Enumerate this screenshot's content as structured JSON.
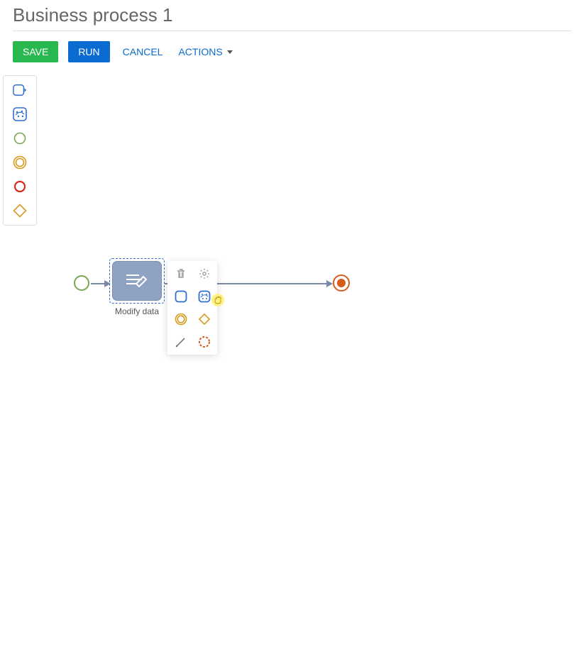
{
  "title": "Business process 1",
  "toolbar": {
    "save": "SAVE",
    "run": "RUN",
    "cancel": "CANCEL",
    "actions": "ACTIONS"
  },
  "palette": {
    "items": [
      {
        "name": "user-task",
        "color": "#2f6fd0"
      },
      {
        "name": "script-task",
        "color": "#2f6fd0"
      },
      {
        "name": "start-event",
        "color": "#7aa854"
      },
      {
        "name": "intermediate-event",
        "color": "#d59a1b"
      },
      {
        "name": "end-event",
        "color": "#d52b1b"
      },
      {
        "name": "gateway",
        "color": "#d59a1b"
      }
    ]
  },
  "canvas": {
    "task_label": "Modify data"
  },
  "context_popup": {
    "items": [
      {
        "name": "delete",
        "color": "#999"
      },
      {
        "name": "settings",
        "color": "#999"
      },
      {
        "name": "user-task",
        "color": "#2f6fd0"
      },
      {
        "name": "script-task",
        "color": "#2f6fd0"
      },
      {
        "name": "intermediate-event",
        "color": "#d59a1b"
      },
      {
        "name": "gateway",
        "color": "#d59a1b"
      },
      {
        "name": "connector",
        "color": "#777"
      },
      {
        "name": "end-event",
        "color": "#d55b1b"
      }
    ]
  }
}
